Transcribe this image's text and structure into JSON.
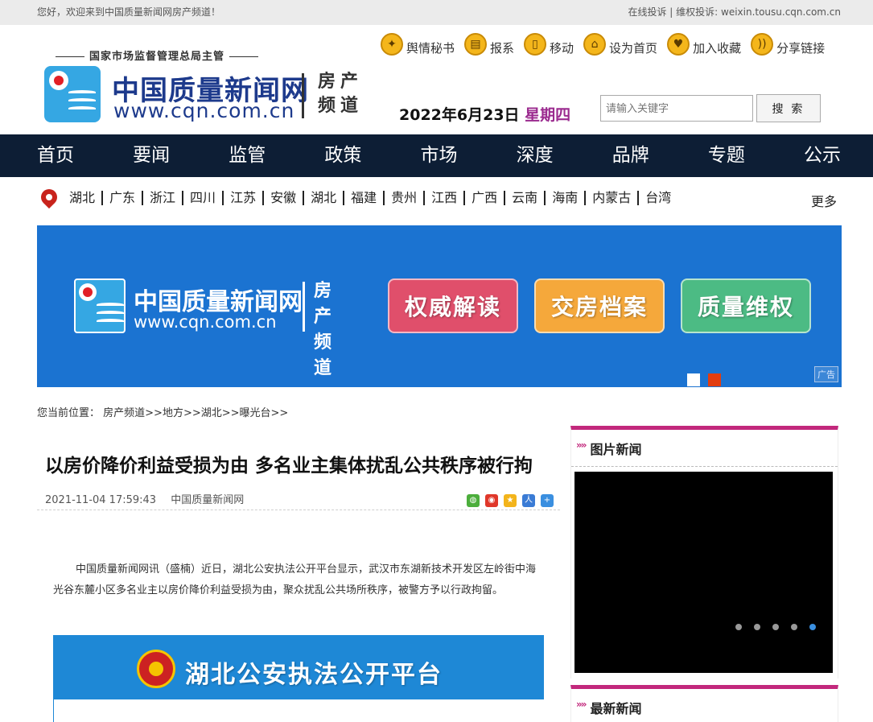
{
  "topbar": {
    "welcome": "您好，欢迎来到中国质量新闻网房产频道！",
    "right": "在线投诉 | 维权投诉: weixin.tousu.cqn.com.cn"
  },
  "header": {
    "supervisor": "国家市场监督管理总局主管",
    "logo_name": "中国质量新闻网",
    "logo_url": "www.cqn.com.cn",
    "logo_sub": "房产频道",
    "quicklinks": [
      {
        "label": "舆情秘书",
        "icon": "bird-icon"
      },
      {
        "label": "报系",
        "icon": "document-icon"
      },
      {
        "label": "移动",
        "icon": "mobile-icon"
      },
      {
        "label": "设为首页",
        "icon": "home-icon"
      },
      {
        "label": "加入收藏",
        "icon": "heart-icon"
      },
      {
        "label": "分享链接",
        "icon": "rss-icon"
      }
    ],
    "date": "2022年6月23日",
    "weekday": "星期四",
    "search_placeholder": "请输入关键字",
    "search_button": "搜 索"
  },
  "nav": [
    "首页",
    "要闻",
    "监管",
    "政策",
    "市场",
    "深度",
    "品牌",
    "专题",
    "公示"
  ],
  "regions": {
    "items": [
      "湖北",
      "广东",
      "浙江",
      "四川",
      "江苏",
      "安徽",
      "湖北",
      "福建",
      "贵州",
      "江西",
      "广西",
      "云南",
      "海南",
      "内蒙古",
      "台湾"
    ],
    "more": "更多"
  },
  "banner": {
    "name": "中国质量新闻网",
    "url": "www.cqn.com.cn",
    "sub": "房产频道",
    "buttons": [
      "权威解读",
      "交房档案",
      "质量维权"
    ],
    "ad_label": "广告",
    "colors": {
      "bg": "#1b73d1",
      "b1": "#e04f6b",
      "b2": "#f5a83b",
      "b3": "#4cbb84"
    }
  },
  "breadcrumb": {
    "label": "您当前位置：",
    "path": "房产频道>>地方>>湖北>>曝光台>>"
  },
  "article": {
    "title": "以房价降价利益受损为由 多名业主集体扰乱公共秩序被行拘",
    "time": "2021-11-04 17:59:43",
    "source": "中国质量新闻网",
    "body": "中国质量新闻网讯（盛楠）近日，湖北公安执法公开平台显示，武汉市东湖新技术开发区左岭街中海光谷东麓小区多名业主以房价降价利益受损为由，聚众扰乱公共场所秩序，被警方予以行政拘留。",
    "image_text": "湖北公安执法公开平台",
    "share_icons": [
      "wechat-icon",
      "weibo-icon",
      "qzone-icon",
      "renren-icon",
      "more-share-icon"
    ]
  },
  "sidebar": {
    "picture_news": "图片新闻",
    "latest_news": "最新新闻",
    "accent": "#c2287c"
  }
}
